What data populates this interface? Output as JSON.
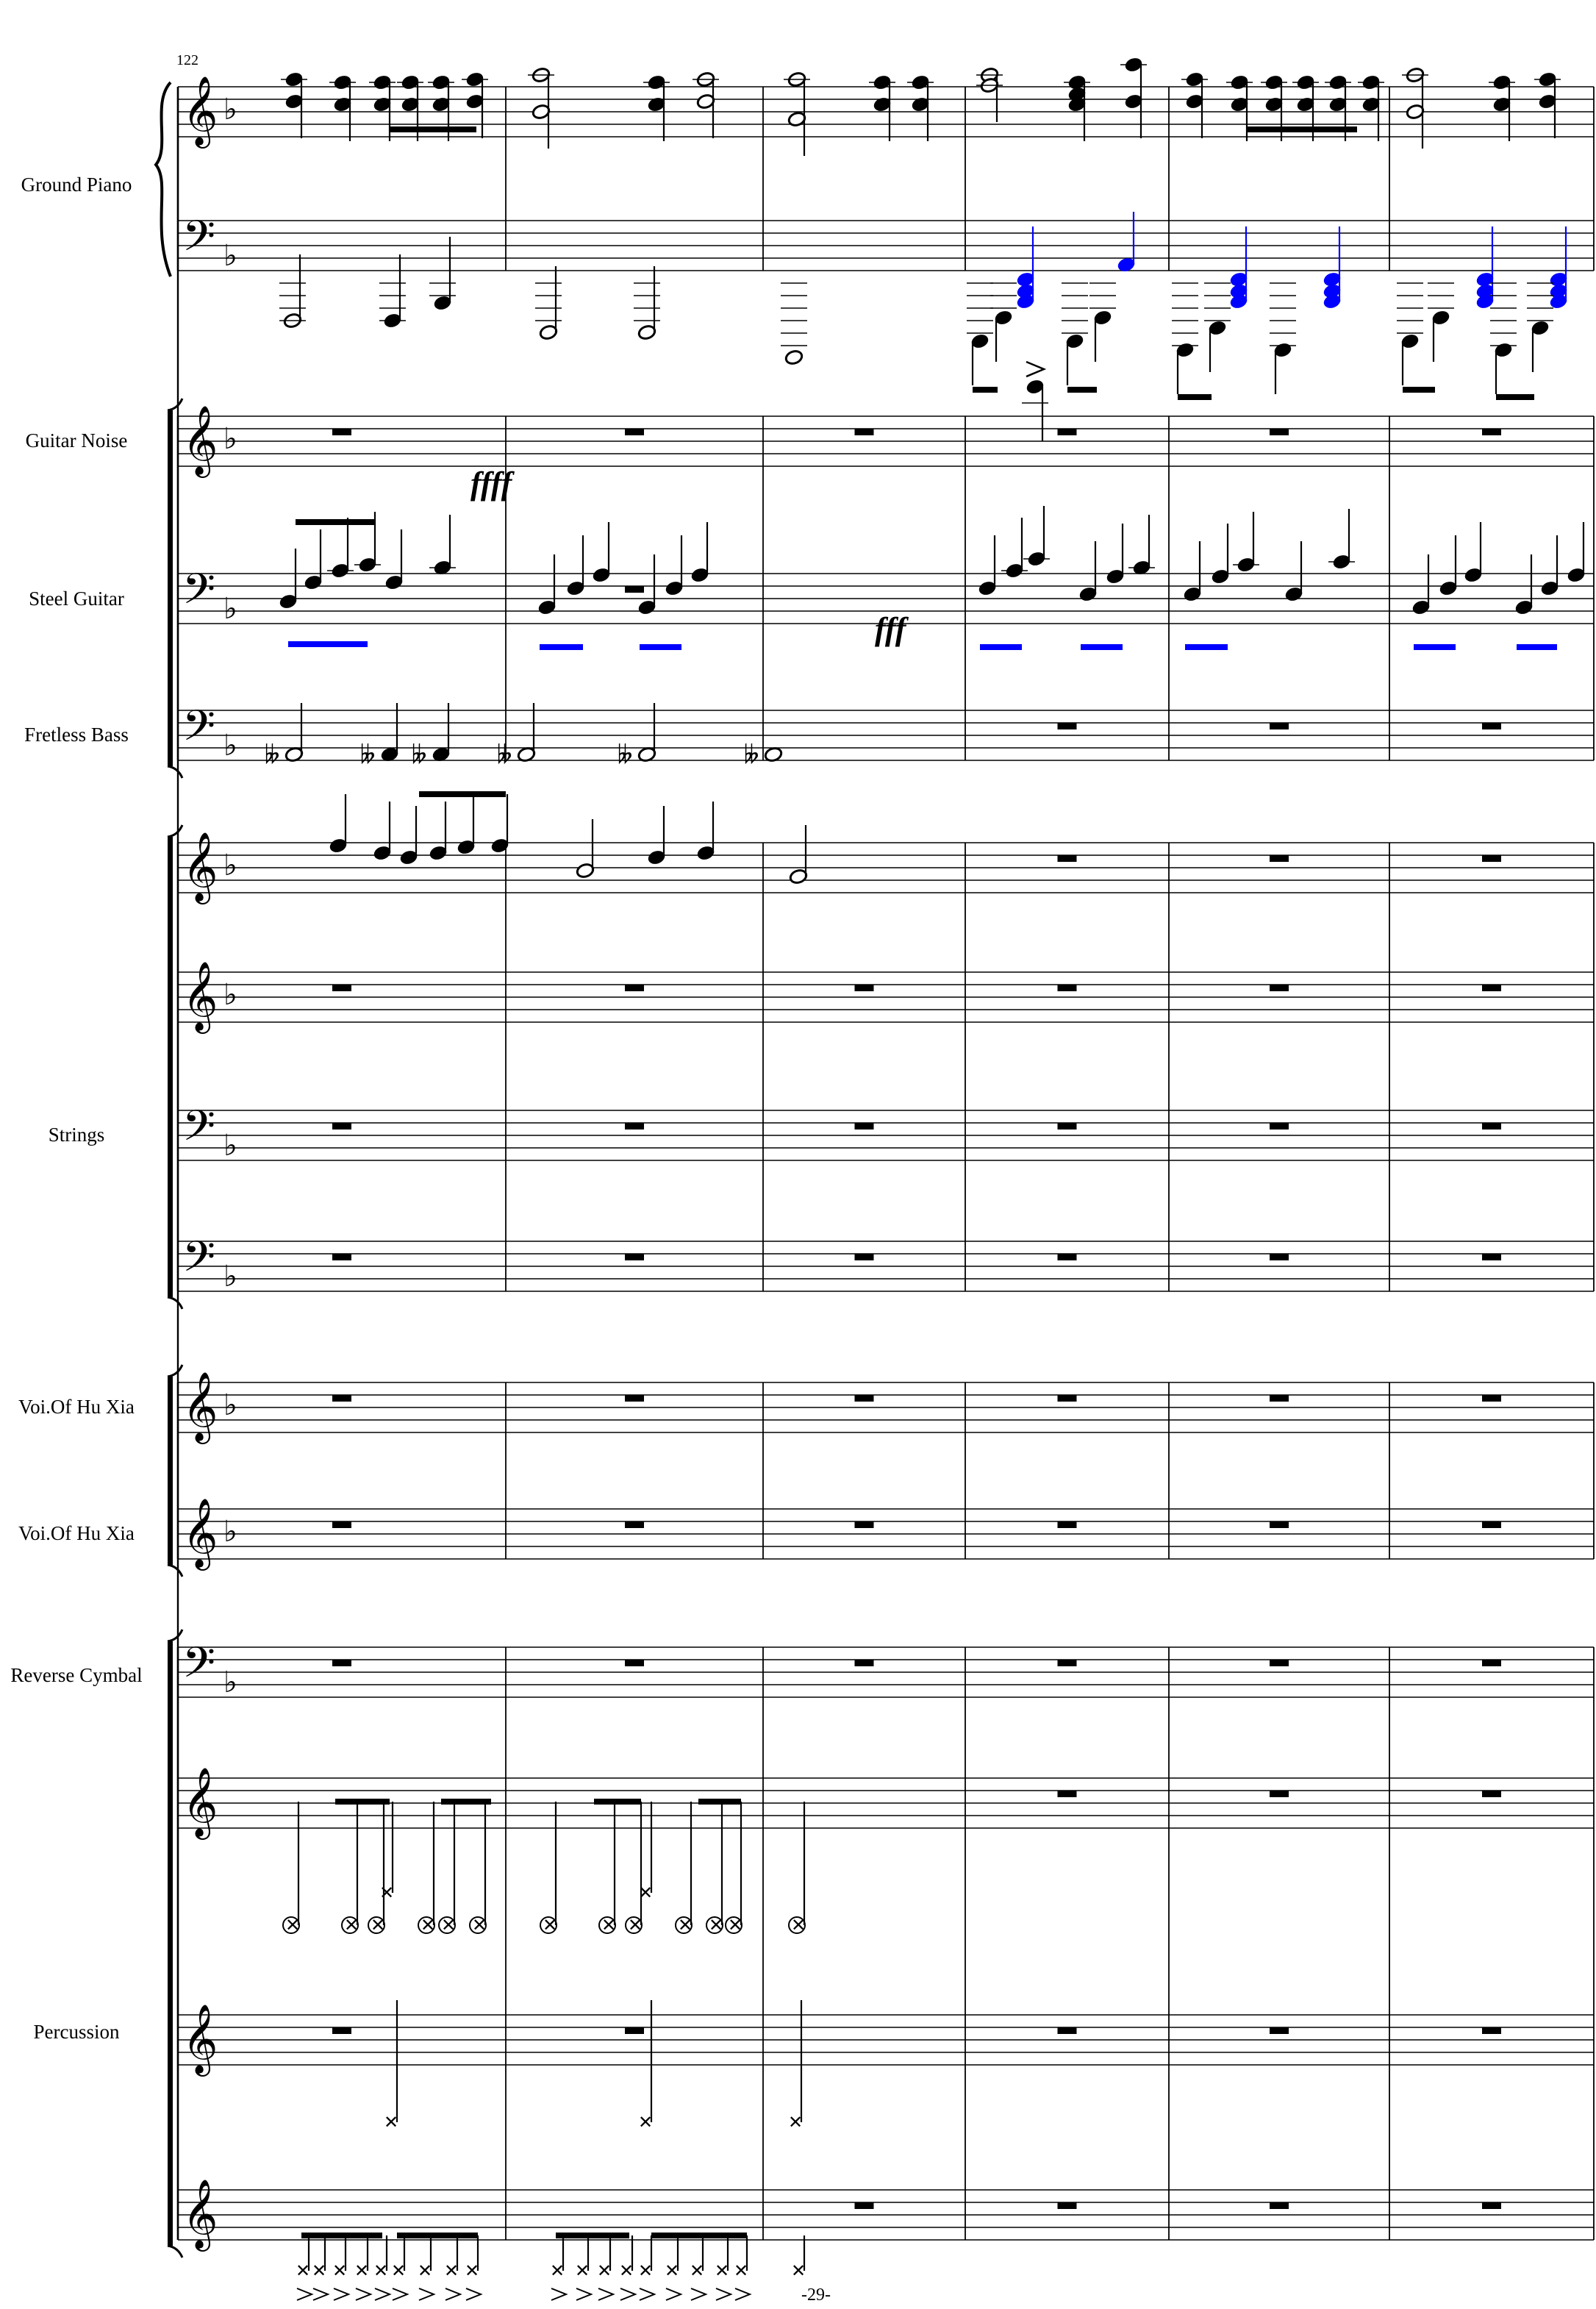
{
  "score": {
    "start_measure_number": "122",
    "page_number": "-29-",
    "colors": {
      "ink": "#000000",
      "highlight": "#0000ff"
    },
    "dynamics": {
      "guitar_noise": "ffff",
      "steel_guitar": "fff"
    },
    "instruments": [
      {
        "key": "ground_piano",
        "label": "Ground Piano"
      },
      {
        "key": "guitar_noise",
        "label": "Guitar Noise"
      },
      {
        "key": "steel_guitar",
        "label": "Steel Guitar"
      },
      {
        "key": "fretless_bass",
        "label": "Fretless Bass"
      },
      {
        "key": "strings",
        "label": "Strings"
      },
      {
        "key": "voice_1",
        "label": "Voi.Of Hu Xia"
      },
      {
        "key": "voice_2",
        "label": "Voi.Of Hu Xia"
      },
      {
        "key": "reverse_cymbal",
        "label": "Reverse Cymbal"
      },
      {
        "key": "percussion",
        "label": "Percussion"
      }
    ]
  }
}
